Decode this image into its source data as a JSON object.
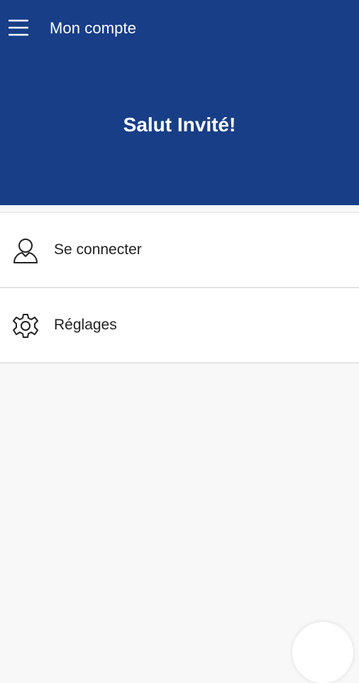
{
  "app_bar": {
    "title": "Mon compte",
    "menu_icon": "hamburger-menu-icon"
  },
  "hero": {
    "greeting": "Salut Invité!"
  },
  "menu": {
    "items": [
      {
        "label": "Se connecter",
        "icon": "user-icon"
      },
      {
        "label": "Réglages",
        "icon": "gear-icon"
      }
    ]
  },
  "colors": {
    "header_bg": "#173e87",
    "page_bg": "#f8f8f8",
    "item_bg": "#ffffff",
    "divider": "#e4e4e4",
    "text_dark": "#222222",
    "text_light": "#ffffff"
  }
}
